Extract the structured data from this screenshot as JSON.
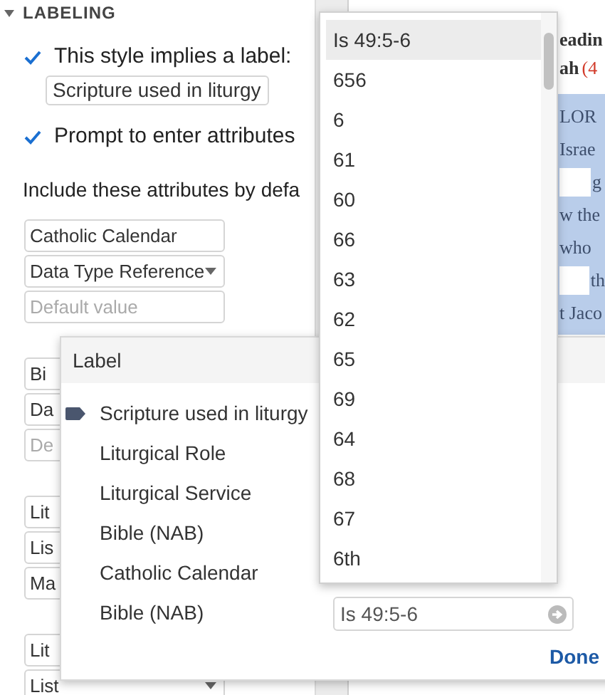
{
  "section": {
    "title": "LABELING",
    "expanded": true
  },
  "options": [
    {
      "label": "This style implies a label:",
      "checked": true,
      "value": "Scripture used in liturgy"
    },
    {
      "label": "Prompt to enter attributes",
      "checked": true
    }
  ],
  "include_label": "Include these attributes by defa",
  "attribute_groups": [
    [
      {
        "kind": "text",
        "value": "Catholic Calendar"
      },
      {
        "kind": "select",
        "value": "Data Type Reference"
      },
      {
        "kind": "text",
        "placeholder": "Default value"
      }
    ],
    [
      {
        "kind": "text",
        "value": "Bi"
      },
      {
        "kind": "text",
        "value": "Da"
      },
      {
        "kind": "text",
        "placeholder": "De"
      }
    ],
    [
      {
        "kind": "text",
        "value": "Lit"
      },
      {
        "kind": "text",
        "value": "Lis"
      },
      {
        "kind": "text",
        "value": "Ma"
      }
    ],
    [
      {
        "kind": "text",
        "value": "Lit"
      },
      {
        "kind": "select",
        "value": "List"
      }
    ]
  ],
  "document": {
    "heading": [
      "eadin",
      "ah"
    ],
    "reference": "(4",
    "lines": [
      {
        "text": "LOR",
        "blank": false
      },
      {
        "text": "Israe",
        "blank": false
      },
      {
        "text": "g",
        "blank": true
      },
      {
        "text": "w the",
        "blank": false
      },
      {
        "text": "who",
        "blank": false
      },
      {
        "text": "th",
        "blank": true
      },
      {
        "text": "t Jaco",
        "blank": false
      }
    ]
  },
  "dropdown": {
    "items": [
      {
        "label": "Is 49:5-6",
        "selected": true
      },
      {
        "label": "656",
        "selected": false
      },
      {
        "label": "6",
        "selected": false
      },
      {
        "label": "61",
        "selected": false
      },
      {
        "label": "60",
        "selected": false
      },
      {
        "label": "66",
        "selected": false
      },
      {
        "label": "63",
        "selected": false
      },
      {
        "label": "62",
        "selected": false
      },
      {
        "label": "65",
        "selected": false
      },
      {
        "label": "69",
        "selected": false
      },
      {
        "label": "64",
        "selected": false
      },
      {
        "label": "68",
        "selected": false
      },
      {
        "label": "67",
        "selected": false
      },
      {
        "label": "6th",
        "selected": false
      }
    ]
  },
  "label_dialog": {
    "title": "Label",
    "items": [
      {
        "label": "Scripture used in liturgy",
        "selected": true
      },
      {
        "label": "Liturgical Role",
        "selected": false
      },
      {
        "label": "Liturgical Service",
        "selected": false
      },
      {
        "label": "Bible (NAB)",
        "selected": false
      },
      {
        "label": "Catholic Calendar",
        "selected": false
      },
      {
        "label": "Bible (NAB)",
        "selected": false
      }
    ],
    "reference": {
      "value": "Is 49:5-6"
    },
    "done": "Done"
  }
}
